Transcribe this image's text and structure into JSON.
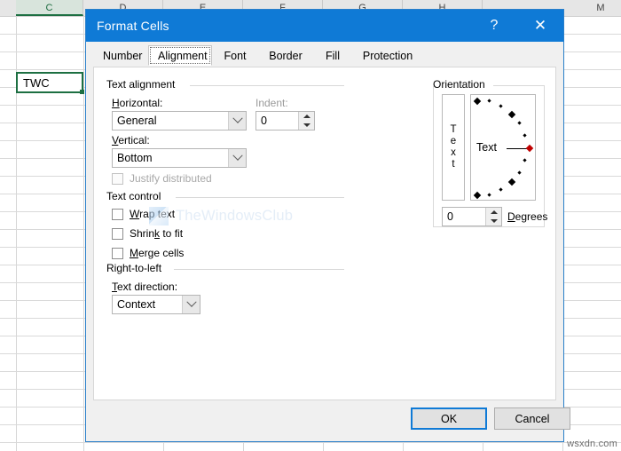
{
  "spreadsheet": {
    "columns": [
      {
        "label": "C",
        "selected": true
      },
      {
        "label": "D",
        "selected": false
      },
      {
        "label": "E",
        "selected": false
      },
      {
        "label": "F",
        "selected": false
      },
      {
        "label": "G",
        "selected": false
      },
      {
        "label": "H",
        "selected": false
      },
      {
        "label": "M",
        "selected": false
      }
    ],
    "selected_cell_value": "TWC",
    "corner_watermark": "wsxdn.com"
  },
  "watermark": {
    "text": "TheWindowsClub",
    "logo_icon": "thewindowsclub-logo-icon"
  },
  "dialog": {
    "title": "Format Cells",
    "help_label": "?",
    "close_label": "✕",
    "tabs": [
      {
        "label": "Number",
        "active": false
      },
      {
        "label": "Alignment",
        "active": true
      },
      {
        "label": "Font",
        "active": false
      },
      {
        "label": "Border",
        "active": false
      },
      {
        "label": "Fill",
        "active": false
      },
      {
        "label": "Protection",
        "active": false
      }
    ],
    "text_alignment": {
      "group_title": "Text alignment",
      "horizontal_label": "Horizontal:",
      "horizontal_value": "General",
      "vertical_label": "Vertical:",
      "vertical_value": "Bottom",
      "indent_label": "Indent:",
      "indent_value": "0",
      "justify_distributed_label": "Justify distributed",
      "justify_distributed_checked": false,
      "justify_distributed_enabled": false
    },
    "text_control": {
      "group_title": "Text control",
      "items": [
        {
          "label": "Wrap text",
          "checked": false
        },
        {
          "label": "Shrink to fit",
          "checked": false
        },
        {
          "label": "Merge cells",
          "checked": false
        }
      ]
    },
    "right_to_left": {
      "group_title": "Right-to-left",
      "text_direction_label": "Text direction:",
      "text_direction_value": "Context"
    },
    "orientation": {
      "group_title": "Orientation",
      "vertical_text_label": "Text",
      "dial_text_label": "Text",
      "degrees_value": "0",
      "degrees_label": "Degrees"
    },
    "footer": {
      "ok_label": "OK",
      "cancel_label": "Cancel"
    }
  },
  "colors": {
    "titlebar": "#0f7ad6",
    "accent": "#0f7ad6",
    "selection_green": "#1d6f42",
    "dial_marker_red": "#c00000"
  }
}
